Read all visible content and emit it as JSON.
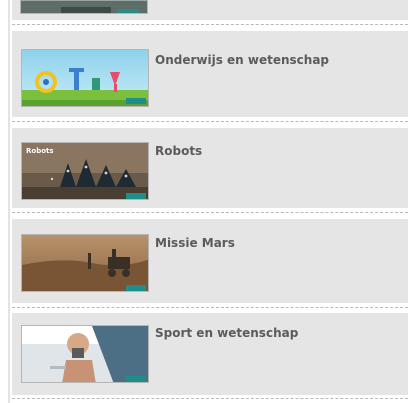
{
  "items": [
    {
      "title": "",
      "thumb": "cut-off-thumbnail"
    },
    {
      "title": "Onderwijs en wetenschap",
      "thumb": "education-thumbnail"
    },
    {
      "title": "Robots",
      "thumb": "robots-thumbnail",
      "thumb_caption": "Robots"
    },
    {
      "title": "Missie Mars",
      "thumb": "mars-thumbnail"
    },
    {
      "title": "Sport en wetenschap",
      "thumb": "sport-thumbnail"
    }
  ],
  "colors": {
    "row_background": "#e5e5e5",
    "title_text": "#5b5b5b",
    "separator": "#b9b9b9"
  }
}
